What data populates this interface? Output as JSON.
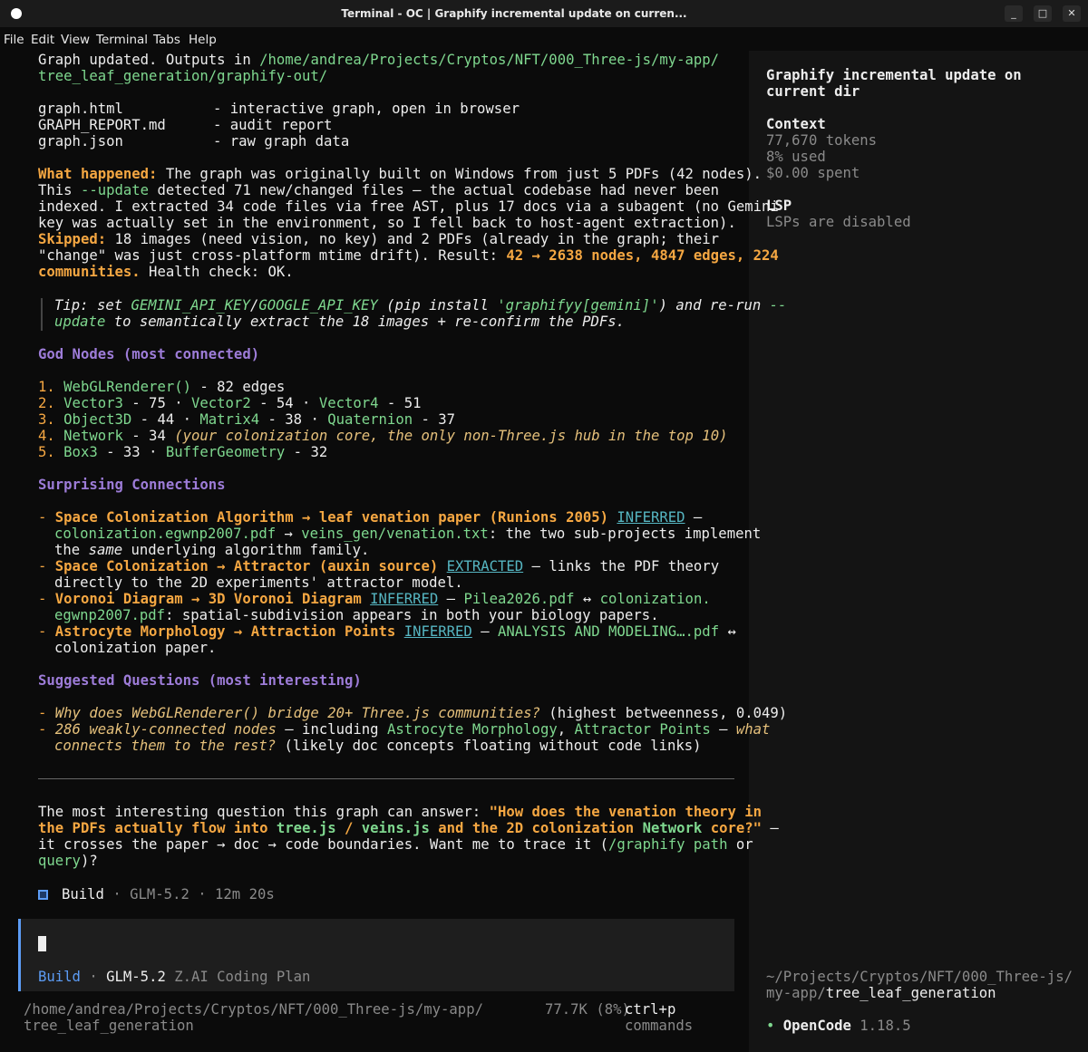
{
  "window": {
    "title": "Terminal - OC | Graphify incremental update on curren...",
    "min_label": "_",
    "max_label": "□",
    "close_label": "✕"
  },
  "menu": [
    "File",
    "Edit",
    "View",
    "Terminal",
    "Tabs",
    "Help"
  ],
  "content": {
    "l1a": "Graph updated. Outputs in ",
    "l1b": "/home/andrea/Projects/Cryptos/NFT/000_Three-js/my-app/",
    "l2": "tree_leaf_generation/graphify-out/",
    "files": [
      {
        "name": "graph.html",
        "desc": "- interactive graph, open in browser"
      },
      {
        "name": "GRAPH_REPORT.md",
        "desc": "- audit report"
      },
      {
        "name": "graph.json",
        "desc": "- raw graph data"
      }
    ],
    "wh_label": "What happened:",
    "wh_1": " The graph was originally built on Windows from just 5 PDFs (42 nodes).",
    "wh_2a": "This ",
    "wh_2b": "--update",
    "wh_2c": " detected 71 new/changed files — the actual codebase had never been",
    "wh_3": "indexed. I extracted 34 code files via free AST, plus 17 docs via a subagent (no Gemini",
    "wh_4": "key was actually set in the environment, so I fell back to host-agent extraction).",
    "sk_label": "Skipped:",
    "sk_1": " 18 images (need vision, no key) and 2 PDFs (already in the graph; their",
    "sk_2a": "\"change\" was just cross-platform mtime drift). Result: ",
    "sk_2b": "42 → 2638 nodes, 4847 edges, 224",
    "sk_3a": "communities.",
    "sk_3b": " Health check: OK.",
    "tip_1a": "Tip: set ",
    "tip_1b": "GEMINI_API_KEY",
    "tip_1c": "/",
    "tip_1d": "GOOGLE_API_KEY",
    "tip_1e": " (pip install ",
    "tip_1f": "'graphifyy[gemini]'",
    "tip_1g": ") and re-run ",
    "tip_1h": "--",
    "tip_2a": "update",
    "tip_2b": " to semantically extract the 18 images + re-confirm the PDFs.",
    "god_heading": "God Nodes (most connected)",
    "god_1": {
      "num": "1.",
      "a": "WebGLRenderer()",
      "b": " - 82 edges"
    },
    "god_2": {
      "num": "2.",
      "a": "Vector3",
      "b": " - 75 · ",
      "c": "Vector2",
      "d": " - 54 · ",
      "e": "Vector4",
      "f": " - 51"
    },
    "god_3": {
      "num": "3.",
      "a": "Object3D",
      "b": " - 44 · ",
      "c": "Matrix4",
      "d": " - 38 · ",
      "e": "Quaternion",
      "f": " - 37"
    },
    "god_4": {
      "num": "4.",
      "a": "Network",
      "b": " - 34 ",
      "c": "(your colonization core, the only non-Three.js hub in the top 10)"
    },
    "god_5": {
      "num": "5.",
      "a": "Box3",
      "b": " - 33 · ",
      "c": "BufferGeometry",
      "d": " - 32"
    },
    "sc_heading": "Surprising Connections",
    "sc_1a": "Space Colonization Algorithm → leaf venation paper (Runions 2005)",
    "sc_1b": "INFERRED",
    "sc_1c": " —",
    "sc_2a": "colonization.egwnp2007.pdf",
    "sc_2b": " → ",
    "sc_2c": "veins_gen/venation.txt",
    "sc_2d": ": the two sub-projects implement",
    "sc_3a": "the ",
    "sc_3b": "same",
    "sc_3c": " underlying algorithm family.",
    "sc_4a": "Space Colonization → Attractor (auxin source)",
    "sc_4b": "EXTRACTED",
    "sc_4c": " — links the PDF theory",
    "sc_5": "directly to the 2D experiments' attractor model.",
    "sc_6a": "Voronoi Diagram → 3D Voronoi Diagram",
    "sc_6b": "INFERRED",
    "sc_6c": " — ",
    "sc_6d": "Pilea2026.pdf",
    "sc_6e": " ↔ ",
    "sc_6f": "colonization.",
    "sc_7a": "egwnp2007.pdf",
    "sc_7b": ": spatial-subdivision appears in both your biology papers.",
    "sc_8a": "Astrocyte Morphology → Attraction Points",
    "sc_8b": "INFERRED",
    "sc_8c": " — ",
    "sc_8d": "ANALYSIS AND MODELING….pdf",
    "sc_8e": " ↔",
    "sc_9": "colonization paper.",
    "sq_heading": "Suggested Questions (most interesting)",
    "sq_1a": "Why does WebGLRenderer() bridge 20+ Three.js communities?",
    "sq_1b": " (highest betweenness, 0.049)",
    "sq_2a": "286 weakly-connected nodes",
    "sq_2b": " — including ",
    "sq_2c": "Astrocyte Morphology",
    "sq_2d": ", ",
    "sq_2e": "Attractor Points",
    "sq_2f": " — ",
    "sq_2g": "what",
    "sq_3a": "connects them to the rest?",
    "sq_3b": " (likely doc concepts floating without code links)",
    "fq_1a": "The most interesting question this graph can answer: ",
    "fq_1b": "\"How does the venation theory in",
    "fq_2a": "the PDFs actually flow into ",
    "fq_2b": "tree.js",
    "fq_2c": " / ",
    "fq_2d": "veins.js",
    "fq_2e": " and the 2D colonization ",
    "fq_2f": "Network",
    "fq_2g": " core?\"",
    "fq_2h": " —",
    "fq_3a": "it crosses the paper → doc → code boundaries. Want me to trace it (",
    "fq_3b": "/graphify path",
    "fq_3c": " or",
    "fq_4a": "query",
    "fq_4b": ")?",
    "status_agent": "Build",
    "status_sep1": " · ",
    "status_model": "GLM-5.2",
    "status_sep2": " · ",
    "status_time": "12m 20s"
  },
  "input": {
    "agent": "Build",
    "sep": " · ",
    "model": "GLM-5.2",
    "provider": " Z.AI Coding Plan"
  },
  "footer": {
    "path_1": "/home/andrea/Projects/Cryptos/NFT/000_Three-js/my-app/",
    "path_2": "tree_leaf_generation",
    "tokens": "77.7K (8%)",
    "shortcut": "ctrl+p",
    "shortcut_label": "commands"
  },
  "sidebar": {
    "title_1": "Graphify incremental update on",
    "title_2": "current dir",
    "context_heading": "Context",
    "tokens": "77,670 tokens",
    "used": "8% used",
    "spent": "$0.00 spent",
    "lsp_heading": "LSP",
    "lsp_status": "LSPs are disabled",
    "dir_1": "~/Projects/Cryptos/NFT/000_Three-js/",
    "dir_2a": "my-app/",
    "dir_2b": "tree_leaf_generation",
    "app_bullet": "•",
    "app_name": "OpenCode",
    "app_version": " 1.18.5"
  },
  "colors": {
    "accent_blue": "#5c9cf5",
    "green": "#7fd88f",
    "orange": "#f5a742",
    "purple": "#9d7cd8",
    "link": "#56b6c2",
    "background": "#0b0b0b",
    "sidebar": "#141414"
  }
}
